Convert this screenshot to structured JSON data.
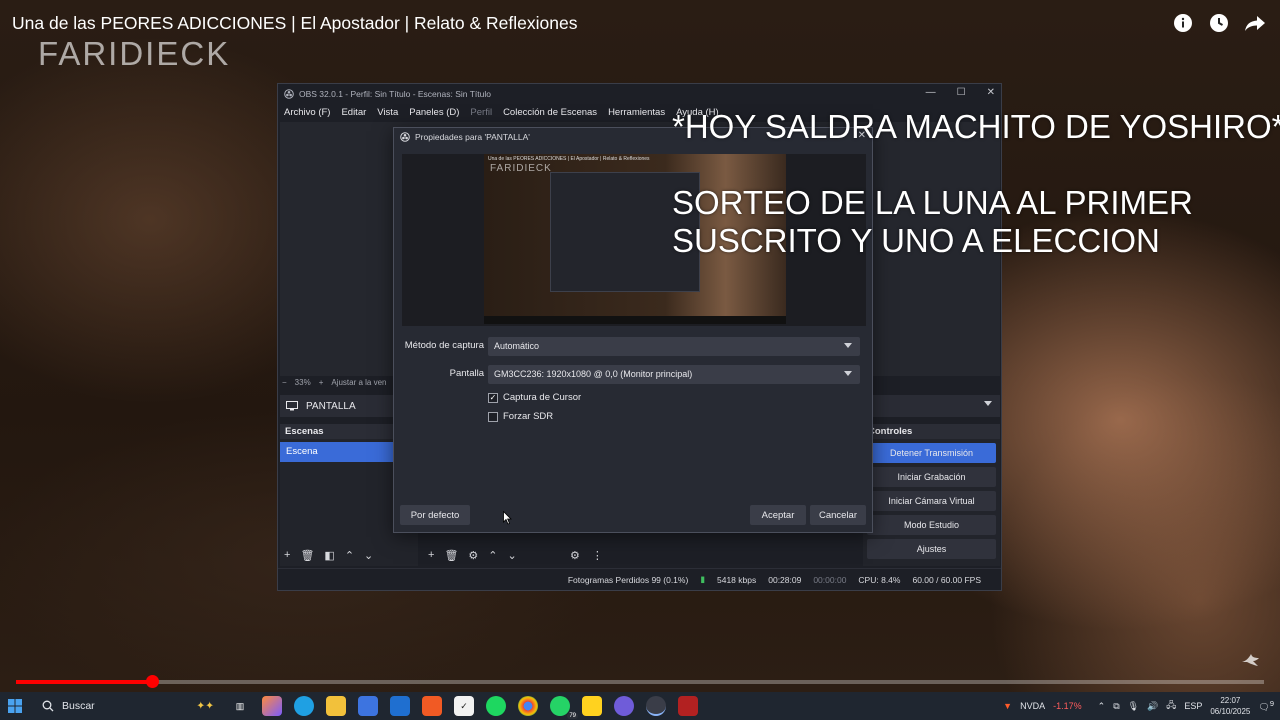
{
  "video": {
    "title": "Una de las PEORES ADICCIONES | El Apostador | Relato & Reflexiones",
    "channel_watermark": "FARIDIECK",
    "progress": 0.109
  },
  "overlay_text": {
    "line1": "*HOY SALDRA MACHITO DE YOSHIRO*",
    "line2": "SORTEO DE LA LUNA AL  PRIMER",
    "line3": "SUSCRITO Y UNO A ELECCION"
  },
  "obs": {
    "window_title": "OBS 32.0.1 - Perfil: Sin Título - Escenas: Sin Título",
    "menu": [
      "Archivo (F)",
      "Editar",
      "Vista",
      "Paneles (D)",
      "Perfil",
      "Colección de Escenas",
      "Herramientas",
      "Ayuda (H)"
    ],
    "zoom": "33%",
    "zoom_hint": "Ajustar a la ven",
    "source_name": "PANTALLA",
    "scenes_header": "Escenas",
    "scene_item": "Escena",
    "controls_header": "Controles",
    "controls": [
      "Detener Transmisión",
      "Iniciar Grabación",
      "Iniciar Cámara Virtual",
      "Modo Estudio",
      "Ajustes"
    ],
    "status": {
      "dropped": "Fotogramas Perdidos 99 (0.1%)",
      "bitrate": "5418 kbps",
      "stream_time": "00:28:09",
      "rec_time": "00:00:00",
      "cpu": "CPU: 8.4%",
      "fps": "60.00 / 60.00 FPS"
    }
  },
  "dialog": {
    "title": "Propiedades para 'PANTALLA'",
    "capture_method_label": "Método de captura",
    "capture_method_value": "Automático",
    "display_label": "Pantalla",
    "display_value": "GM3CC236: 1920x1080 @ 0,0 (Monitor principal)",
    "capture_cursor": "Captura de Cursor",
    "capture_cursor_checked": true,
    "force_sdr": "Forzar SDR",
    "force_sdr_checked": false,
    "defaults_button": "Por defecto",
    "ok_button": "Aceptar",
    "cancel_button": "Cancelar",
    "mini_title": "Una de las PEORES ADICCIONES | El Apostador | Relato & Reflexiones",
    "mini_brand": "FARIDIECK"
  },
  "taskbar": {
    "search_placeholder": "Buscar",
    "stock_name": "NVDA",
    "stock_change": "-1.17%",
    "language": "ESP",
    "time": "22:07",
    "date": "06/10/2025",
    "whatsapp_badge": "79",
    "notification_count": "9"
  },
  "colors": {
    "accent": "#3a6bd8",
    "progress": "#ff0000",
    "stock_negative": "#ff5c5c"
  }
}
